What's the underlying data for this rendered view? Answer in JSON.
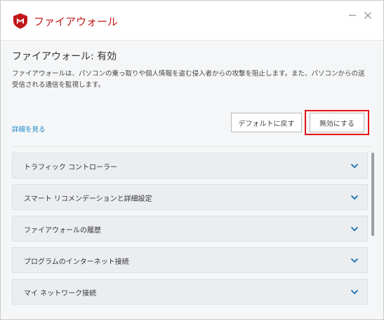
{
  "window": {
    "app_title": "ファイアウォール",
    "minimize_label": "—",
    "close_label": "✕"
  },
  "main": {
    "title": "ファイアウォール: 有効",
    "description": "ファイアウォールは、パソコンの乗っ取りや個人情報を盗む侵入者からの攻撃を阻止します。また、パソコンからの送受信される通信を監視します。",
    "more_link": "詳細を見る",
    "default_button": "デフォルトに戻す",
    "disable_button": "無効にする"
  },
  "sections": [
    {
      "label": "トラフィック コントローラー"
    },
    {
      "label": "スマート リコメンデーションと詳細設定"
    },
    {
      "label": "ファイアウォールの履歴"
    },
    {
      "label": "プログラムのインターネット接続"
    },
    {
      "label": "マイ ネットワーク接続"
    }
  ],
  "colors": {
    "brand": "#c01818",
    "link": "#1a87c9",
    "highlight": "#e81414"
  }
}
